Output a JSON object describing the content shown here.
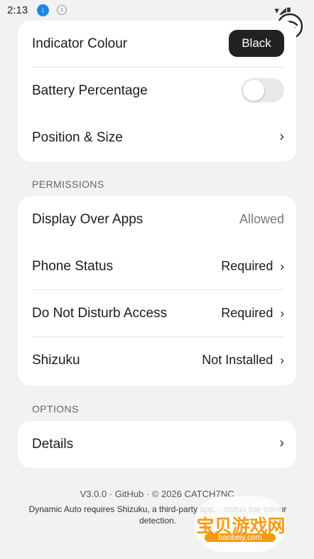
{
  "status_bar": {
    "time": "2:13"
  },
  "indicator_card": {
    "rows": [
      {
        "label": "Indicator Colour",
        "value": "Black"
      },
      {
        "label": "Battery Percentage"
      },
      {
        "label": "Position & Size"
      }
    ]
  },
  "permissions": {
    "title": "PERMISSIONS",
    "rows": [
      {
        "label": "Display Over Apps",
        "value": "Allowed"
      },
      {
        "label": "Phone Status",
        "value": "Required"
      },
      {
        "label": "Do Not Disturb Access",
        "value": "Required"
      },
      {
        "label": "Shizuku",
        "value": "Not Installed"
      }
    ]
  },
  "options": {
    "title": "OPTIONS",
    "rows": [
      {
        "label": "Details"
      }
    ]
  },
  "footer": {
    "version": "V3.0.0",
    "github": "GitHub",
    "copyright": "© 2026 CATCH7NC",
    "desc": "Dynamic Auto requires Shizuku, a third-party app... status bar colour detection."
  },
  "watermark": {
    "text": "宝贝游戏网",
    "url": "baobeiy.com"
  }
}
